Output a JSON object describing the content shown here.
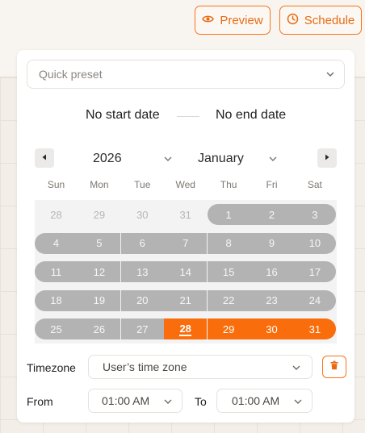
{
  "toolbar": {
    "preview_label": "Preview",
    "schedule_label": "Schedule",
    "accent_color": "#f97316"
  },
  "preset": {
    "placeholder": "Quick preset"
  },
  "range": {
    "start": "No start date",
    "end": "No end date"
  },
  "calendar": {
    "year": "2026",
    "month": "January",
    "weekdays": [
      "Sun",
      "Mon",
      "Tue",
      "Wed",
      "Thu",
      "Fri",
      "Sat"
    ],
    "weeks": [
      [
        "28",
        "29",
        "30",
        "31",
        "1",
        "2",
        "3"
      ],
      [
        "4",
        "5",
        "6",
        "7",
        "8",
        "9",
        "10"
      ],
      [
        "11",
        "12",
        "13",
        "14",
        "15",
        "16",
        "17"
      ],
      [
        "18",
        "19",
        "20",
        "21",
        "22",
        "23",
        "24"
      ],
      [
        "25",
        "26",
        "27",
        "28",
        "29",
        "30",
        "31"
      ]
    ],
    "today": "28",
    "selected": [
      "28",
      "29",
      "30",
      "31"
    ],
    "range_color": "#b3b3b3",
    "selected_color": "#f96d0c"
  },
  "timezone": {
    "label": "Timezone",
    "value": "User’s time zone"
  },
  "time": {
    "from_label": "From",
    "from_value": "01:00 AM",
    "to_label": "To",
    "to_value": "01:00 AM"
  },
  "icons": {
    "preview": "eye-icon",
    "schedule": "clock-icon",
    "delete": "trash-icon",
    "prev": "triangle-left-icon",
    "next": "triangle-right-icon",
    "dropdown": "chevron-down-icon"
  }
}
